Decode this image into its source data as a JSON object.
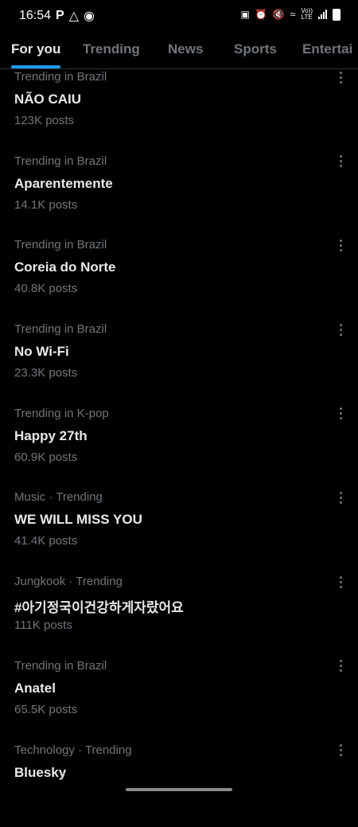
{
  "status_bar": {
    "time": "16:54",
    "left_icons": [
      "pinterest-icon",
      "notification-icon",
      "shazam-icon"
    ],
    "right_icons": [
      "battery-saver-icon",
      "alarm-icon",
      "mute-icon",
      "wifi-icon",
      "signal-icon",
      "battery-icon"
    ],
    "volte_label": "Vo))",
    "lte_label": "LTE"
  },
  "tabs": [
    {
      "label": "For you",
      "active": true
    },
    {
      "label": "Trending",
      "active": false
    },
    {
      "label": "News",
      "active": false
    },
    {
      "label": "Sports",
      "active": false
    },
    {
      "label": "Entertai",
      "active": false
    }
  ],
  "trends": [
    {
      "context": "Trending in Brazil",
      "title": "NÃO CAIU",
      "count": "123K posts"
    },
    {
      "context": "Trending in Brazil",
      "title": "Aparentemente",
      "count": "14.1K posts"
    },
    {
      "context": "Trending in Brazil",
      "title": "Coreia do Norte",
      "count": "40.8K posts"
    },
    {
      "context": "Trending in Brazil",
      "title": "No Wi-Fi",
      "count": "23.3K posts"
    },
    {
      "context": "Trending in K-pop",
      "title": "Happy 27th",
      "count": "60.9K posts"
    },
    {
      "context": "Music · Trending",
      "title": "WE WILL MISS YOU",
      "count": "41.4K posts"
    },
    {
      "context": "Jungkook · Trending",
      "title": "#아기정국이건강하게자랐어요",
      "count": "111K posts"
    },
    {
      "context": "Trending in Brazil",
      "title": "Anatel",
      "count": "65.5K posts"
    },
    {
      "context": "Technology · Trending",
      "title": "Bluesky",
      "count": ""
    }
  ],
  "colors": {
    "background": "#000000",
    "primary_text": "#e7e9ea",
    "secondary_text": "#71767b",
    "accent": "#1d9bf0"
  }
}
